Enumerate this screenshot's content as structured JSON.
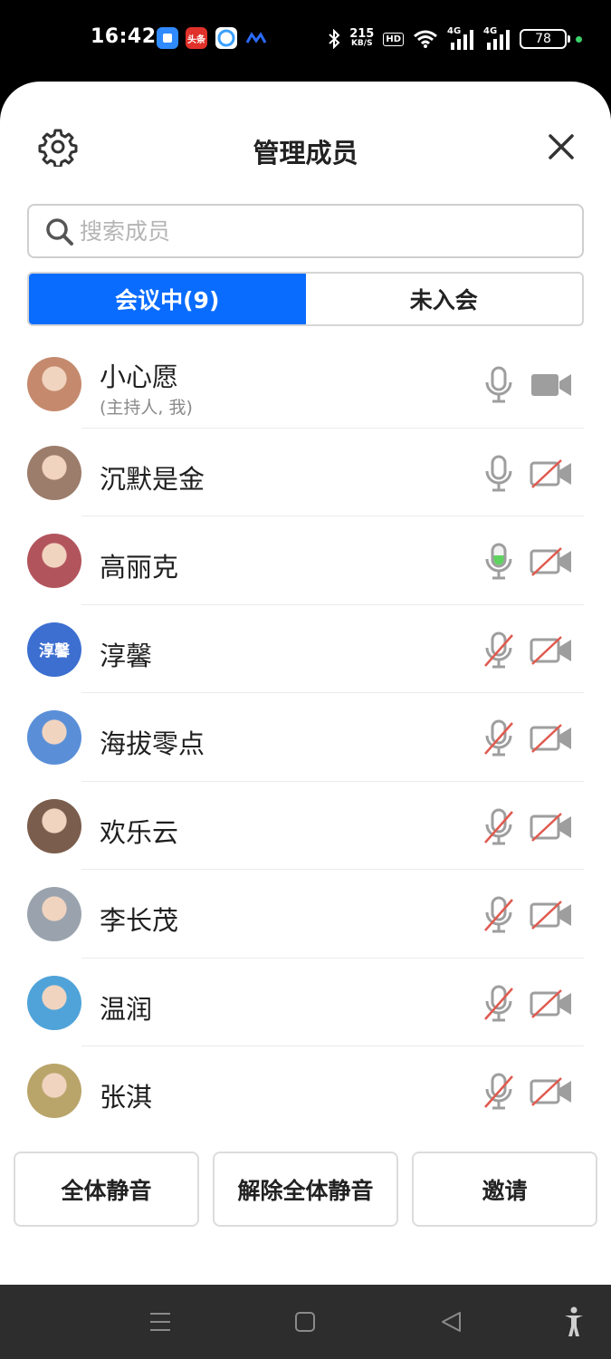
{
  "status_bar": {
    "time": "16:42",
    "app_icons": [
      {
        "name": "app-icon-blue",
        "color": "#2f8bff"
      },
      {
        "name": "toutiao-icon",
        "label": "头条",
        "color": "#e0312a"
      },
      {
        "name": "app-icon-cloud",
        "color": "#3aa0ff"
      },
      {
        "name": "app-icon-wave",
        "color": "#2a6bff"
      }
    ],
    "net_speed_value": "215",
    "net_speed_unit": "KB/S",
    "hd_label": "HD",
    "signal1_label": "4G",
    "signal2_label": "4G",
    "battery": "78"
  },
  "sheet": {
    "title": "管理成员",
    "search_placeholder": "搜索成员",
    "tabs": [
      {
        "label": "会议中(9)",
        "active": true
      },
      {
        "label": "未入会",
        "active": false
      }
    ],
    "members": [
      {
        "name": "小心愿",
        "role": "(主持人, 我)",
        "mic": "on",
        "camera": "on",
        "avatar": "photo",
        "avatar_color": "#c58a6e"
      },
      {
        "name": "沉默是金",
        "mic": "on",
        "camera": "off",
        "avatar": "photo",
        "avatar_color": "#9c7c6a"
      },
      {
        "name": "高丽克",
        "mic": "speaking",
        "camera": "off",
        "avatar": "photo",
        "avatar_color": "#b2545c"
      },
      {
        "name": "淳馨",
        "avatar_text": "淳馨",
        "mic": "muted",
        "camera": "off",
        "avatar": "text",
        "avatar_color": "#3d6fd1"
      },
      {
        "name": "海拔零点",
        "mic": "muted",
        "camera": "off",
        "avatar": "photo",
        "avatar_color": "#5a8fd8"
      },
      {
        "name": "欢乐云",
        "mic": "muted",
        "camera": "off",
        "avatar": "photo",
        "avatar_color": "#7a5d4c"
      },
      {
        "name": "李长茂",
        "mic": "muted",
        "camera": "off",
        "avatar": "photo",
        "avatar_color": "#9aa3ad"
      },
      {
        "name": "温润",
        "mic": "muted",
        "camera": "off",
        "avatar": "photo",
        "avatar_color": "#4fa3d9"
      },
      {
        "name": "张淇",
        "mic": "muted",
        "camera": "off",
        "avatar": "photo",
        "avatar_color": "#b9a56a"
      }
    ],
    "actions": {
      "mute_all": "全体静音",
      "unmute_all": "解除全体静音",
      "invite": "邀请"
    }
  },
  "colors": {
    "accent": "#0a6cff",
    "speaking_green": "#5fd35f",
    "muted_red": "#e05a4f",
    "icon_gray": "#9e9e9e"
  },
  "nav_bar": {
    "icons": [
      "menu-icon",
      "home-icon",
      "back-icon",
      "accessibility-icon"
    ]
  }
}
